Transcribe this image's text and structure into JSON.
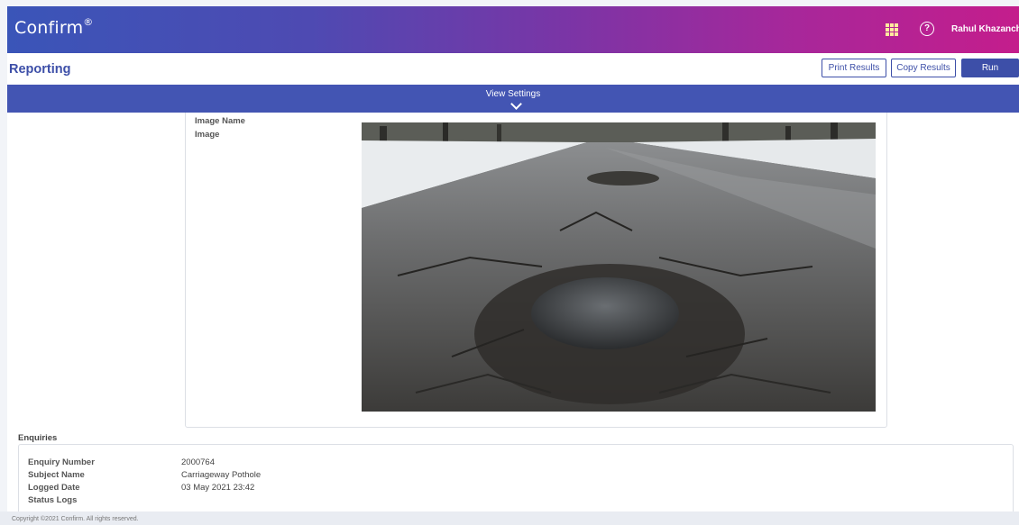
{
  "header": {
    "brand": "Confirm",
    "brand_mark": "®",
    "apps_icon": "app-grid-icon",
    "help_icon": "help-circle-icon",
    "help_glyph": "?",
    "user_name": "Rahul Khazanch"
  },
  "toolbar": {
    "page_title": "Reporting",
    "print_label": "Print Results",
    "copy_label": "Copy Results",
    "run_label": "Run"
  },
  "view_settings": {
    "label": "View Settings",
    "icon": "chevron-down-icon"
  },
  "image_section": {
    "image_name_label": "Image Name",
    "image_label": "Image",
    "image_content": "road-pothole-photo"
  },
  "enquiries": {
    "title": "Enquiries",
    "fields": [
      {
        "label": "Enquiry Number",
        "value": "2000764"
      },
      {
        "label": "Subject Name",
        "value": "Carriageway Pothole"
      },
      {
        "label": "Logged Date",
        "value": "03 May 2021 23:42"
      },
      {
        "label": "Status Logs",
        "value": ""
      }
    ]
  },
  "footer": {
    "copyright": "Copyright ©2021 Confirm. All rights reserved."
  },
  "colors": {
    "accent": "#3d4fa8",
    "settings_bar": "#4355b3",
    "gradient_start": "#3a55b8",
    "gradient_end": "#c41d8c"
  }
}
